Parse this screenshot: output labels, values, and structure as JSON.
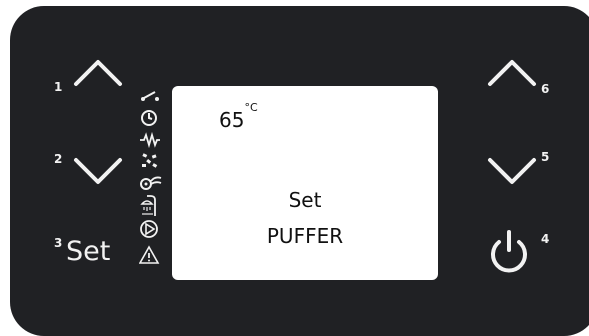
{
  "display": {
    "temperature_value": "65",
    "temperature_unit": "°C",
    "line1": "Set",
    "line2": "PUFFER"
  },
  "buttons": {
    "up_left": {
      "number": "1",
      "icon": "chevron-up-icon"
    },
    "down_left": {
      "number": "2",
      "icon": "chevron-down-icon"
    },
    "set": {
      "number": "3",
      "label": "Set"
    },
    "power": {
      "number": "4",
      "icon": "power-icon"
    },
    "down_right": {
      "number": "5",
      "icon": "chevron-down-icon"
    },
    "up_right": {
      "number": "6",
      "icon": "chevron-up-icon"
    }
  },
  "status_icons": [
    "switch-icon",
    "clock-icon",
    "resistance-icon",
    "pellet-icon",
    "fan-icon",
    "shower-icon",
    "pump-icon",
    "warning-icon"
  ],
  "colors": {
    "panel": "#202124",
    "symbols": "#f2f2f2",
    "lcd_background": "#ffffff",
    "lcd_text": "#111111"
  }
}
